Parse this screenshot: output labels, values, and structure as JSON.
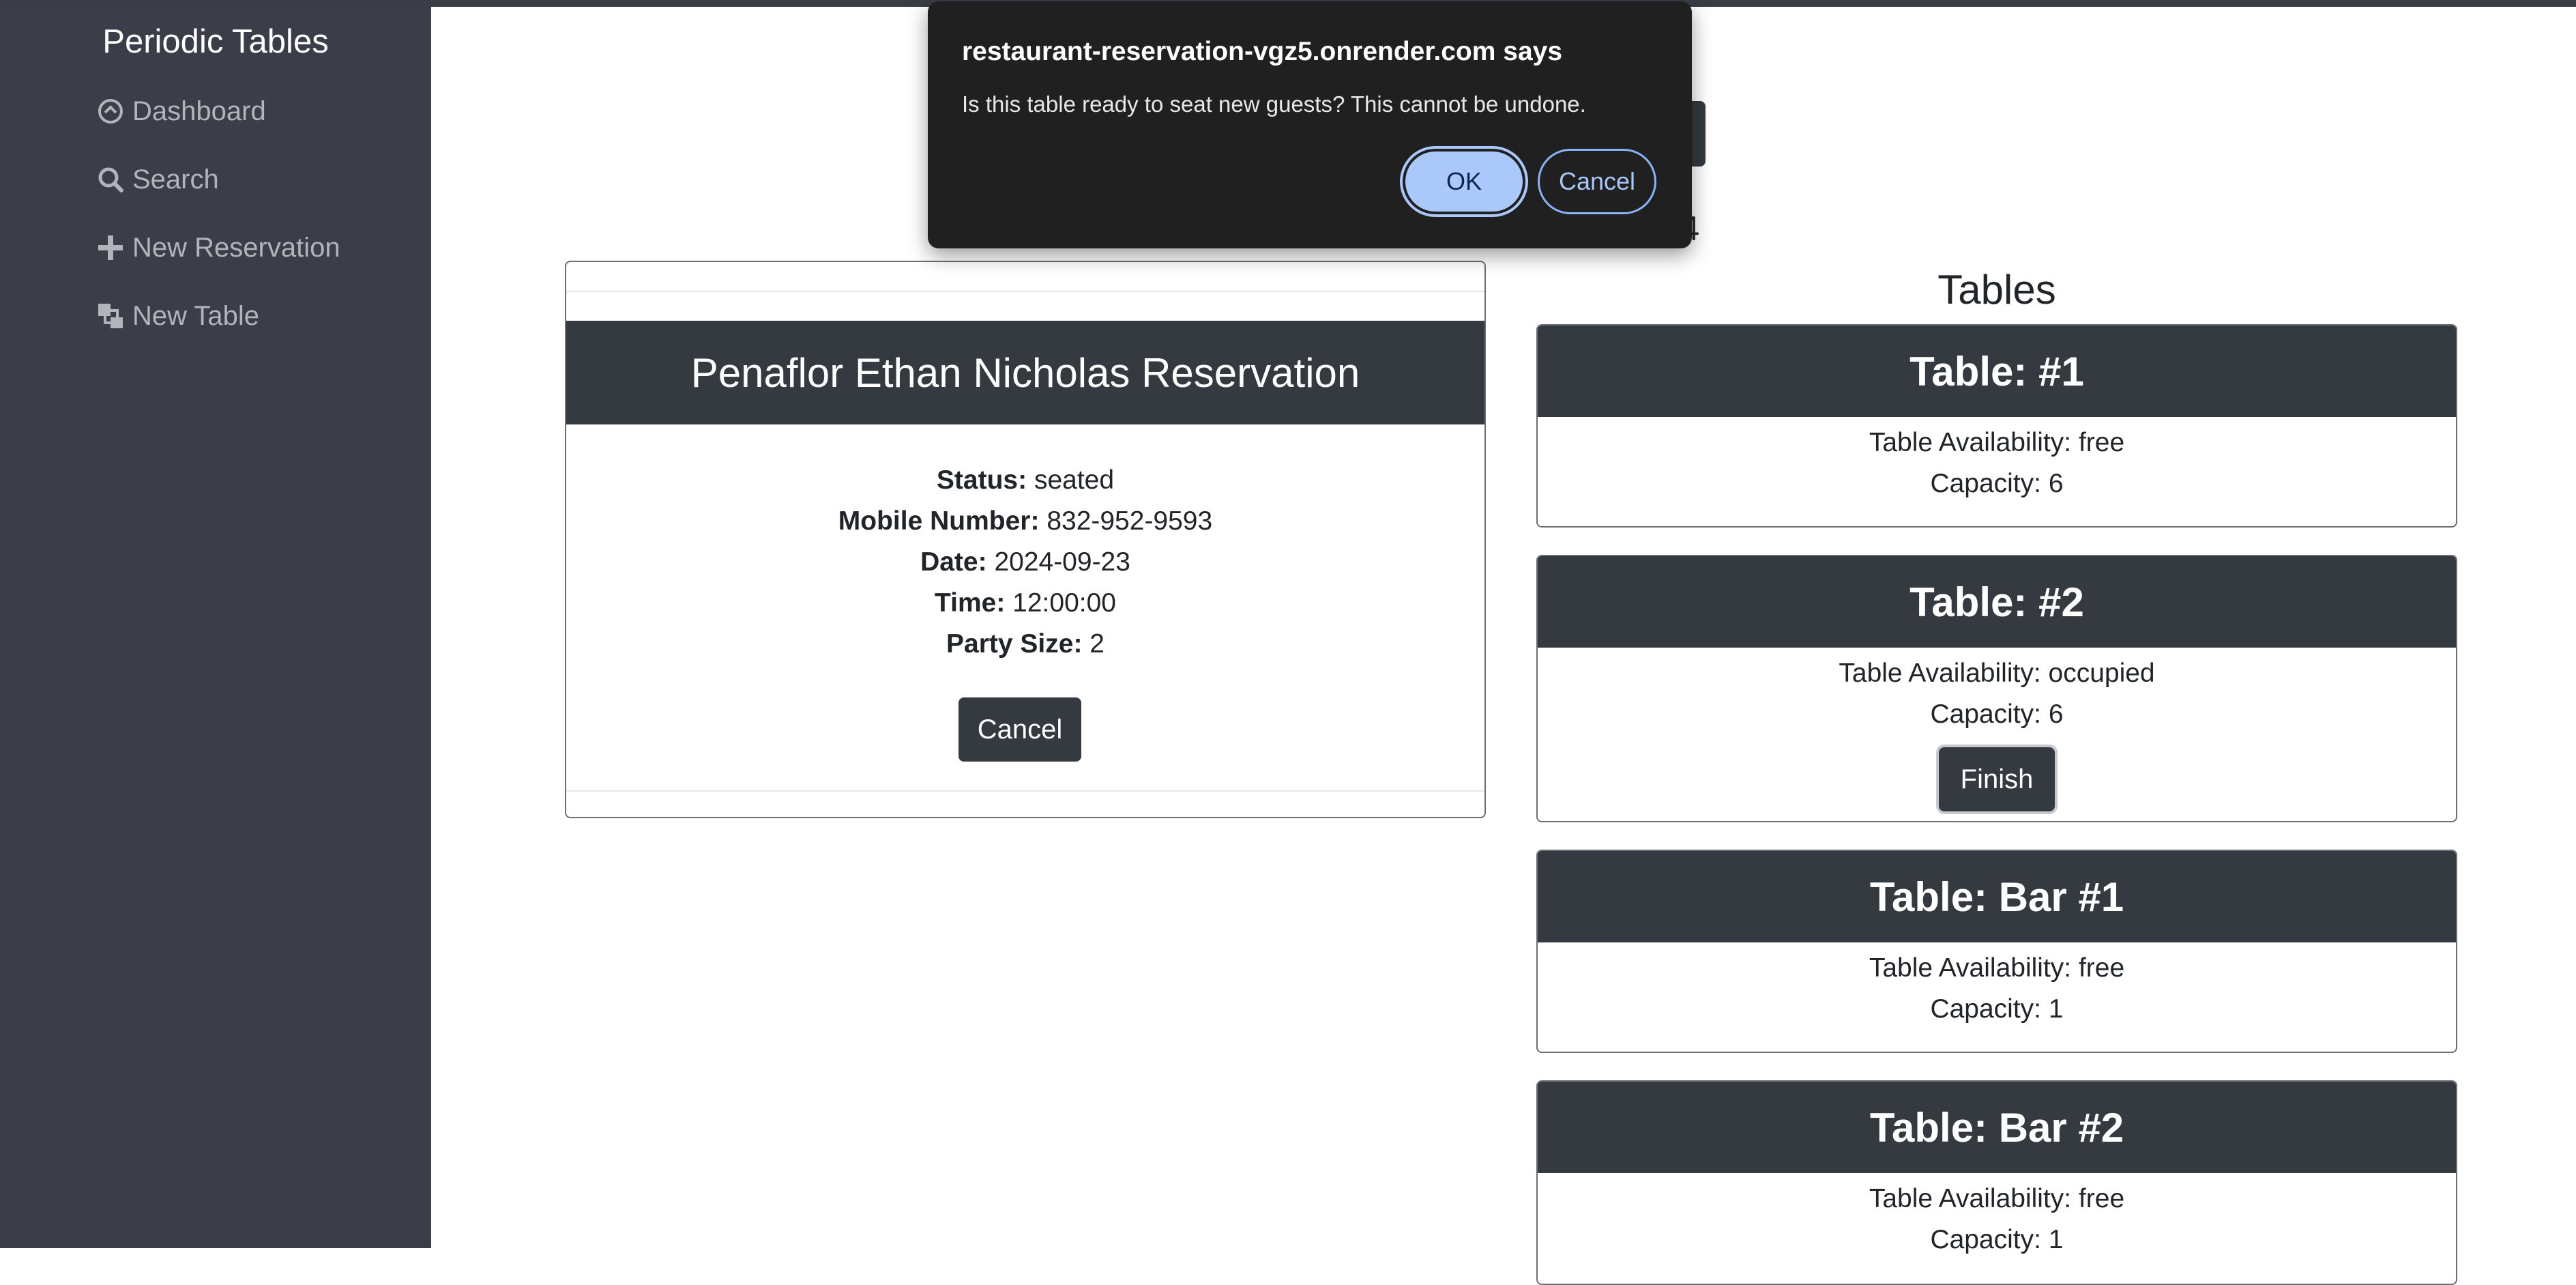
{
  "sidebar": {
    "brand": "Periodic Tables",
    "items": [
      {
        "label": "Dashboard",
        "icon": "dashboard-icon"
      },
      {
        "label": "Search",
        "icon": "search-icon"
      },
      {
        "label": "New Reservation",
        "icon": "plus-icon"
      },
      {
        "label": "New Table",
        "icon": "table-icon"
      }
    ]
  },
  "main": {
    "date_fragment": "2024"
  },
  "reservation": {
    "title": "Penaflor Ethan Nicholas Reservation",
    "status_label": "Status:",
    "status": "seated",
    "mobile_label": "Mobile Number:",
    "mobile": "832-952-9593",
    "date_label": "Date:",
    "date": "2024-09-23",
    "time_label": "Time:",
    "time": "12:00:00",
    "party_label": "Party Size:",
    "party": "2",
    "cancel_label": "Cancel"
  },
  "tables": {
    "title": "Tables",
    "items": [
      {
        "name": "Table: #1",
        "availability": "Table Availability: free",
        "capacity": "Capacity: 6"
      },
      {
        "name": "Table: #2",
        "availability": "Table Availability: occupied",
        "capacity": "Capacity: 6",
        "finish_label": "Finish"
      },
      {
        "name": "Table: Bar #1",
        "availability": "Table Availability: free",
        "capacity": "Capacity: 1"
      },
      {
        "name": "Table: Bar #2",
        "availability": "Table Availability: free",
        "capacity": "Capacity: 1"
      }
    ]
  },
  "dialog": {
    "title": "restaurant-reservation-vgz5.onrender.com says",
    "message": "Is this table ready to seat new guests? This cannot be undone.",
    "ok_label": "OK",
    "cancel_label": "Cancel"
  },
  "colors": {
    "sidebar_bg": "#3b3d48",
    "card_header": "#343a40",
    "dialog_bg": "#202020",
    "dialog_ok": "#aac8fa"
  }
}
